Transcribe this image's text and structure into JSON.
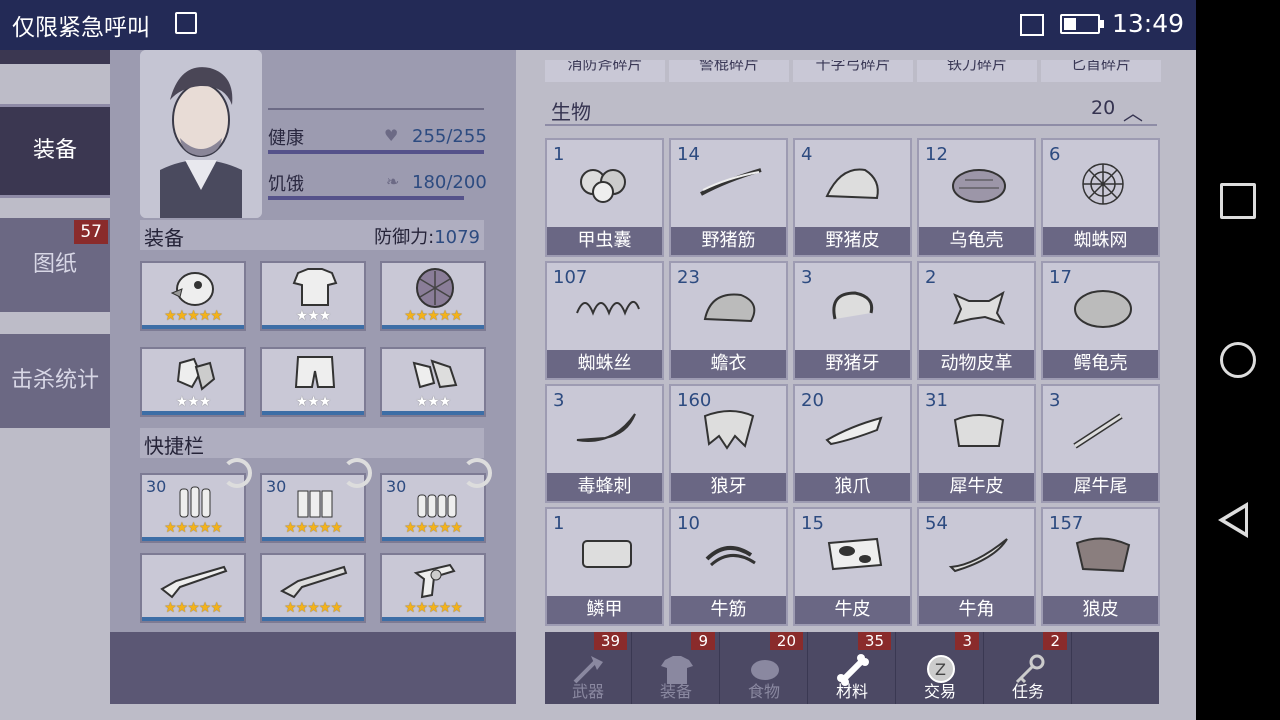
{
  "status_bar": {
    "carrier_text": "仅限紧急呼叫",
    "time": "13:49"
  },
  "side_tabs": [
    {
      "label": "装备",
      "active": true
    },
    {
      "label": "图纸",
      "badge": "57"
    },
    {
      "label": "击杀统计"
    }
  ],
  "character": {
    "health_label": "健康",
    "health_value": "255/255",
    "hunger_label": "饥饿",
    "hunger_value": "180/200",
    "equip_title": "装备",
    "defense_label": "防御力:",
    "defense_value": "1079",
    "quickbar_title": "快捷栏",
    "equipment": [
      {
        "icon": "bird-helmet-icon",
        "stars": 5,
        "gold": true
      },
      {
        "icon": "torn-shirt-icon",
        "stars": 3,
        "gold": false
      },
      {
        "icon": "turtle-shell-armor-icon",
        "stars": 5,
        "gold": true
      },
      {
        "icon": "gloves-icon",
        "stars": 3,
        "gold": false
      },
      {
        "icon": "shorts-icon",
        "stars": 3,
        "gold": false
      },
      {
        "icon": "sneakers-icon",
        "stars": 3,
        "gold": false
      }
    ],
    "quickbar": [
      {
        "icon": "rifle-ammo-icon",
        "count": "30",
        "stars": 5
      },
      {
        "icon": "shotgun-shells-icon",
        "count": "30",
        "stars": 5
      },
      {
        "icon": "pistol-ammo-icon",
        "count": "30",
        "stars": 5
      },
      {
        "icon": "rifle-icon",
        "stars": 5
      },
      {
        "icon": "shotgun-icon",
        "stars": 5
      },
      {
        "icon": "revolver-icon",
        "stars": 5
      }
    ]
  },
  "inventory": {
    "broken_header": [
      "消防斧碎片",
      "警棍碎片",
      "十字弓碎片",
      "铁刀碎片",
      "匕首碎片"
    ],
    "category": "生物",
    "category_count": "20",
    "chevron": "︿",
    "items": [
      {
        "num": "1",
        "name": "甲虫囊",
        "icon": "beetle-sac-icon"
      },
      {
        "num": "14",
        "name": "野猪筋",
        "icon": "boar-tendon-icon"
      },
      {
        "num": "4",
        "name": "野猪皮",
        "icon": "boar-hide-icon"
      },
      {
        "num": "12",
        "name": "乌龟壳",
        "icon": "turtle-shell-icon"
      },
      {
        "num": "6",
        "name": "蜘蛛网",
        "icon": "spider-web-icon"
      },
      {
        "num": "107",
        "name": "蜘蛛丝",
        "icon": "spider-silk-icon"
      },
      {
        "num": "23",
        "name": "蟾衣",
        "icon": "toad-skin-icon"
      },
      {
        "num": "3",
        "name": "野猪牙",
        "icon": "boar-tusk-icon"
      },
      {
        "num": "2",
        "name": "动物皮革",
        "icon": "animal-leather-icon"
      },
      {
        "num": "17",
        "name": "鳄龟壳",
        "icon": "snapping-turtle-shell-icon"
      },
      {
        "num": "3",
        "name": "毒蜂刺",
        "icon": "wasp-stinger-icon"
      },
      {
        "num": "160",
        "name": "狼牙",
        "icon": "wolf-fang-icon"
      },
      {
        "num": "20",
        "name": "狼爪",
        "icon": "wolf-claw-icon"
      },
      {
        "num": "31",
        "name": "犀牛皮",
        "icon": "rhino-hide-icon"
      },
      {
        "num": "3",
        "name": "犀牛尾",
        "icon": "rhino-tail-icon"
      },
      {
        "num": "1",
        "name": "鳞甲",
        "icon": "scale-armor-icon"
      },
      {
        "num": "10",
        "name": "牛筋",
        "icon": "ox-tendon-icon"
      },
      {
        "num": "15",
        "name": "牛皮",
        "icon": "cowhide-icon"
      },
      {
        "num": "54",
        "name": "牛角",
        "icon": "ox-horn-icon"
      },
      {
        "num": "157",
        "name": "狼皮",
        "icon": "wolf-pelt-icon"
      }
    ]
  },
  "bottom_tabs": [
    {
      "label": "武器",
      "badge": "39",
      "icon": "axe-icon"
    },
    {
      "label": "装备",
      "badge": "9",
      "icon": "shirt-icon"
    },
    {
      "label": "食物",
      "badge": "20",
      "icon": "meat-icon"
    },
    {
      "label": "材料",
      "badge": "35",
      "icon": "bone-icon",
      "active": true
    },
    {
      "label": "交易",
      "badge": "3",
      "icon": "coin-icon"
    },
    {
      "label": "任务",
      "badge": "2",
      "icon": "key-icon"
    }
  ]
}
